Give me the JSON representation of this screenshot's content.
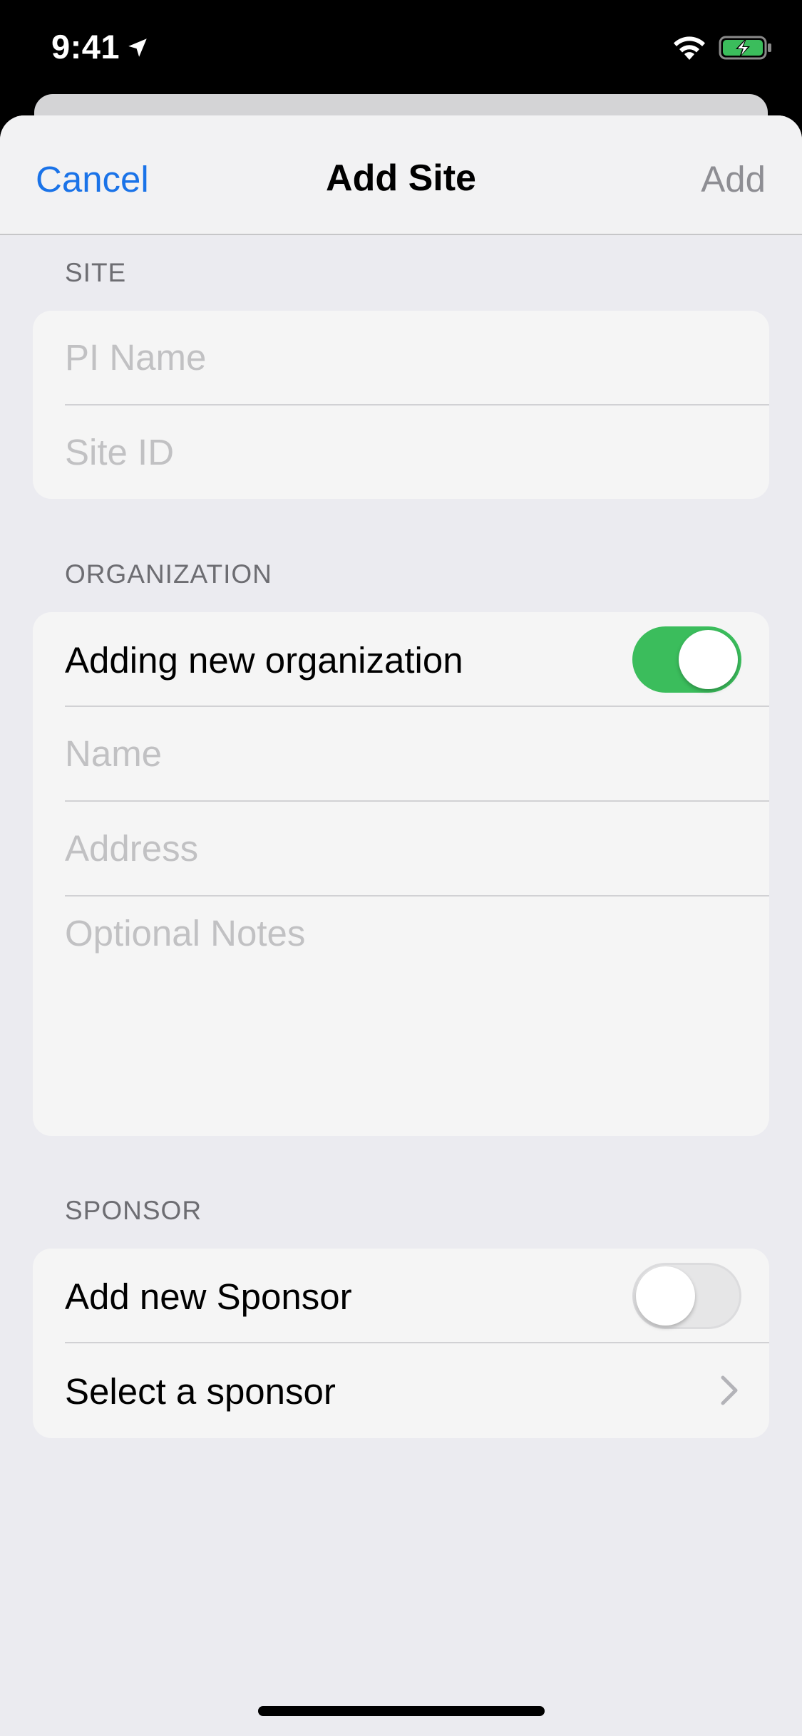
{
  "status_bar": {
    "time": "9:41",
    "icons": [
      "location-arrow-icon",
      "wifi-icon",
      "battery-charging-icon"
    ],
    "battery_color": "#3bbd5c"
  },
  "nav": {
    "cancel_label": "Cancel",
    "title": "Add Site",
    "add_label": "Add",
    "accent_color": "#1a73e8",
    "disabled_color": "#8e8e93"
  },
  "site_section": {
    "header": "SITE",
    "pi_name_placeholder": "PI Name",
    "site_id_placeholder": "Site ID"
  },
  "organization_section": {
    "header": "ORGANIZATION",
    "toggle_label": "Adding new organization",
    "toggle_on": true,
    "name_placeholder": "Name",
    "address_placeholder": "Address",
    "notes_placeholder": "Optional Notes"
  },
  "sponsor_section": {
    "header": "SPONSOR",
    "toggle_label": "Add new Sponsor",
    "toggle_on": false,
    "select_label": "Select a sponsor"
  },
  "toggle_on_color": "#3bbd5c"
}
